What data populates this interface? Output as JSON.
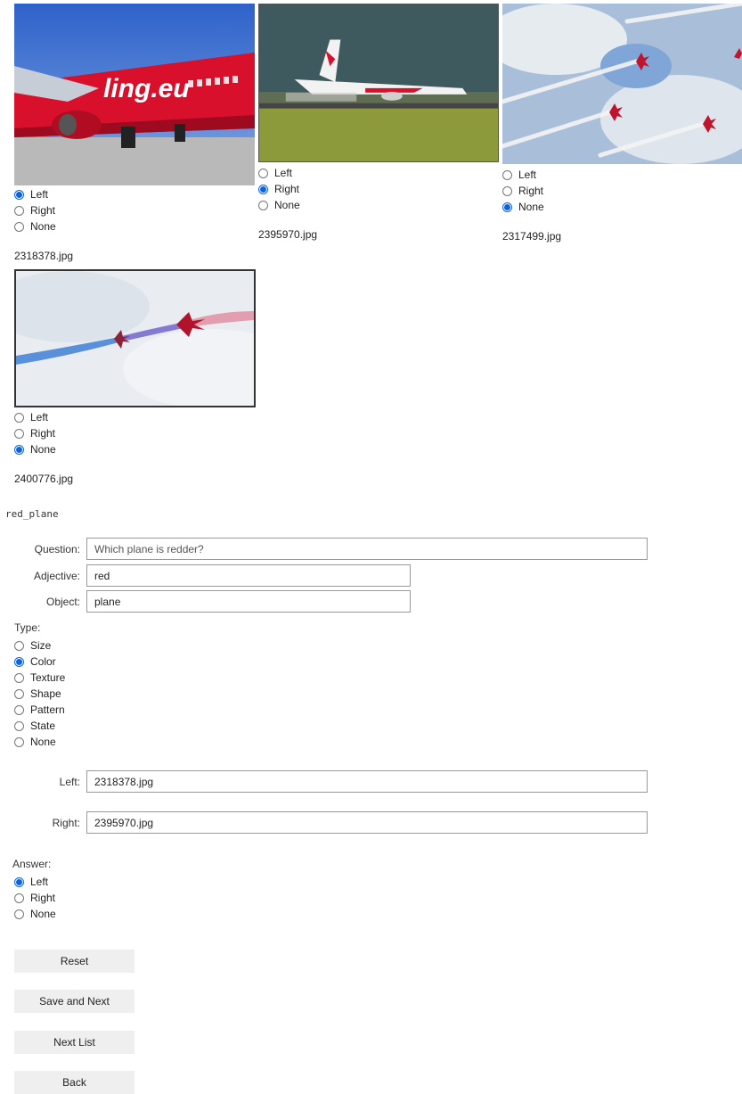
{
  "images": [
    {
      "filename": "2318378.jpg",
      "thumb_text": "ling.eu",
      "selection": "Left",
      "options": [
        "Left",
        "Right",
        "None"
      ]
    },
    {
      "filename": "2395970.jpg",
      "selection": "Right",
      "options": [
        "Left",
        "Right",
        "None"
      ]
    },
    {
      "filename": "2317499.jpg",
      "selection": "None",
      "options": [
        "Left",
        "Right",
        "None"
      ]
    },
    {
      "filename": "2400776.jpg",
      "selection": "None",
      "options": [
        "Left",
        "Right",
        "None"
      ]
    }
  ],
  "list_name": "red_plane",
  "form": {
    "question_label": "Question:",
    "question_placeholder": "Which plane is redder?",
    "adjective_label": "Adjective:",
    "adjective_value": "red",
    "object_label": "Object:",
    "object_value": "plane",
    "type_label": "Type:",
    "type_options": [
      "Size",
      "Color",
      "Texture",
      "Shape",
      "Pattern",
      "State",
      "None"
    ],
    "type_selected": "Color",
    "left_label": "Left:",
    "left_value": "2318378.jpg",
    "right_label": "Right:",
    "right_value": "2395970.jpg",
    "answer_label": "Answer:",
    "answer_options": [
      "Left",
      "Right",
      "None"
    ],
    "answer_selected": "Left"
  },
  "buttons": {
    "reset": "Reset",
    "save_next": "Save and Next",
    "next_list": "Next List",
    "back": "Back"
  },
  "colors": {
    "accent": "#0b63e4",
    "button_bg": "#efefef"
  }
}
